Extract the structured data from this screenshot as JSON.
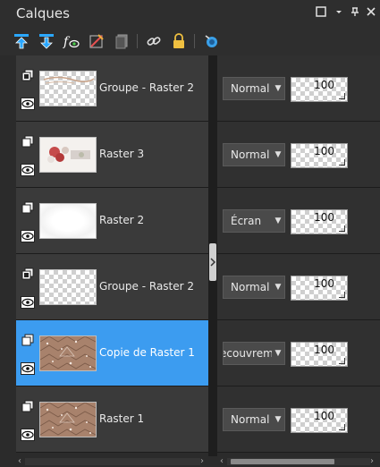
{
  "panel": {
    "title": "Calques"
  },
  "window_controls": [
    {
      "name": "maximize-icon",
      "glyph": "☐"
    },
    {
      "name": "dropdown-icon",
      "glyph": "▾"
    },
    {
      "name": "pin-icon",
      "glyph": "⊥"
    },
    {
      "name": "close-icon",
      "glyph": "✕"
    }
  ],
  "toolbar": [
    "move-layer-up-icon",
    "move-layer-down-icon",
    "edit-effects-icon",
    "delete-layer-icon",
    "duplicate-layer-icon",
    "link-layer-icon",
    "lock-layer-icon",
    "palette-icon"
  ],
  "layers": [
    {
      "name": "Groupe - Raster 2",
      "type": "group",
      "blend": "Normal",
      "opacity": "100",
      "selected": false,
      "thumb": "checker-text"
    },
    {
      "name": "Raster 3",
      "type": "raster",
      "blend": "Normal",
      "opacity": "100",
      "selected": false,
      "thumb": "flowers"
    },
    {
      "name": "Raster 2",
      "type": "raster",
      "blend": "Écran",
      "opacity": "100",
      "selected": false,
      "thumb": "white-fade"
    },
    {
      "name": "Groupe - Raster 2",
      "type": "group",
      "blend": "Normal",
      "opacity": "100",
      "selected": false,
      "thumb": "checker"
    },
    {
      "name": "Copie de Raster 1",
      "type": "raster",
      "blend": "Recouvrement",
      "blend_visible": "ecouvreme",
      "opacity": "100",
      "selected": true,
      "thumb": "brown-lace"
    },
    {
      "name": "Raster 1",
      "type": "raster",
      "blend": "Normal",
      "opacity": "100",
      "selected": false,
      "thumb": "brown-lace"
    }
  ],
  "colors": {
    "selected_row": "#3c9cf0",
    "row_background": "#3a3a3a",
    "panel_background": "#2b2b2b"
  }
}
